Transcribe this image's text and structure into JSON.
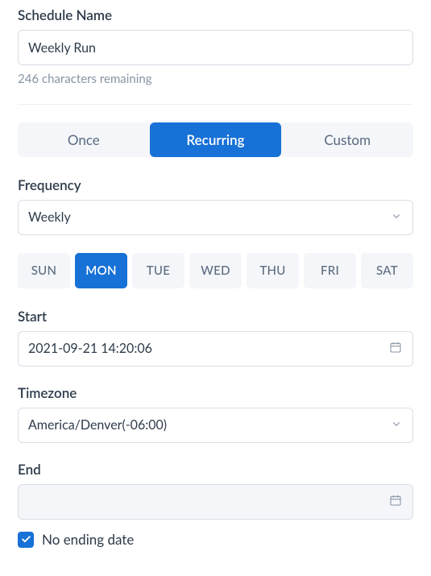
{
  "schedule_name": {
    "label": "Schedule Name",
    "value": "Weekly Run",
    "hint": "246 characters remaining"
  },
  "tabs": {
    "once": "Once",
    "recurring": "Recurring",
    "custom": "Custom"
  },
  "frequency": {
    "label": "Frequency",
    "value": "Weekly"
  },
  "days": {
    "sun": "SUN",
    "mon": "MON",
    "tue": "TUE",
    "wed": "WED",
    "thu": "THU",
    "fri": "FRI",
    "sat": "SAT"
  },
  "start": {
    "label": "Start",
    "value": "2021-09-21 14:20:06"
  },
  "timezone": {
    "label": "Timezone",
    "value": "America/Denver(-06:00)"
  },
  "end": {
    "label": "End",
    "value": "",
    "no_end_label": "No ending date",
    "no_end_checked": true
  }
}
